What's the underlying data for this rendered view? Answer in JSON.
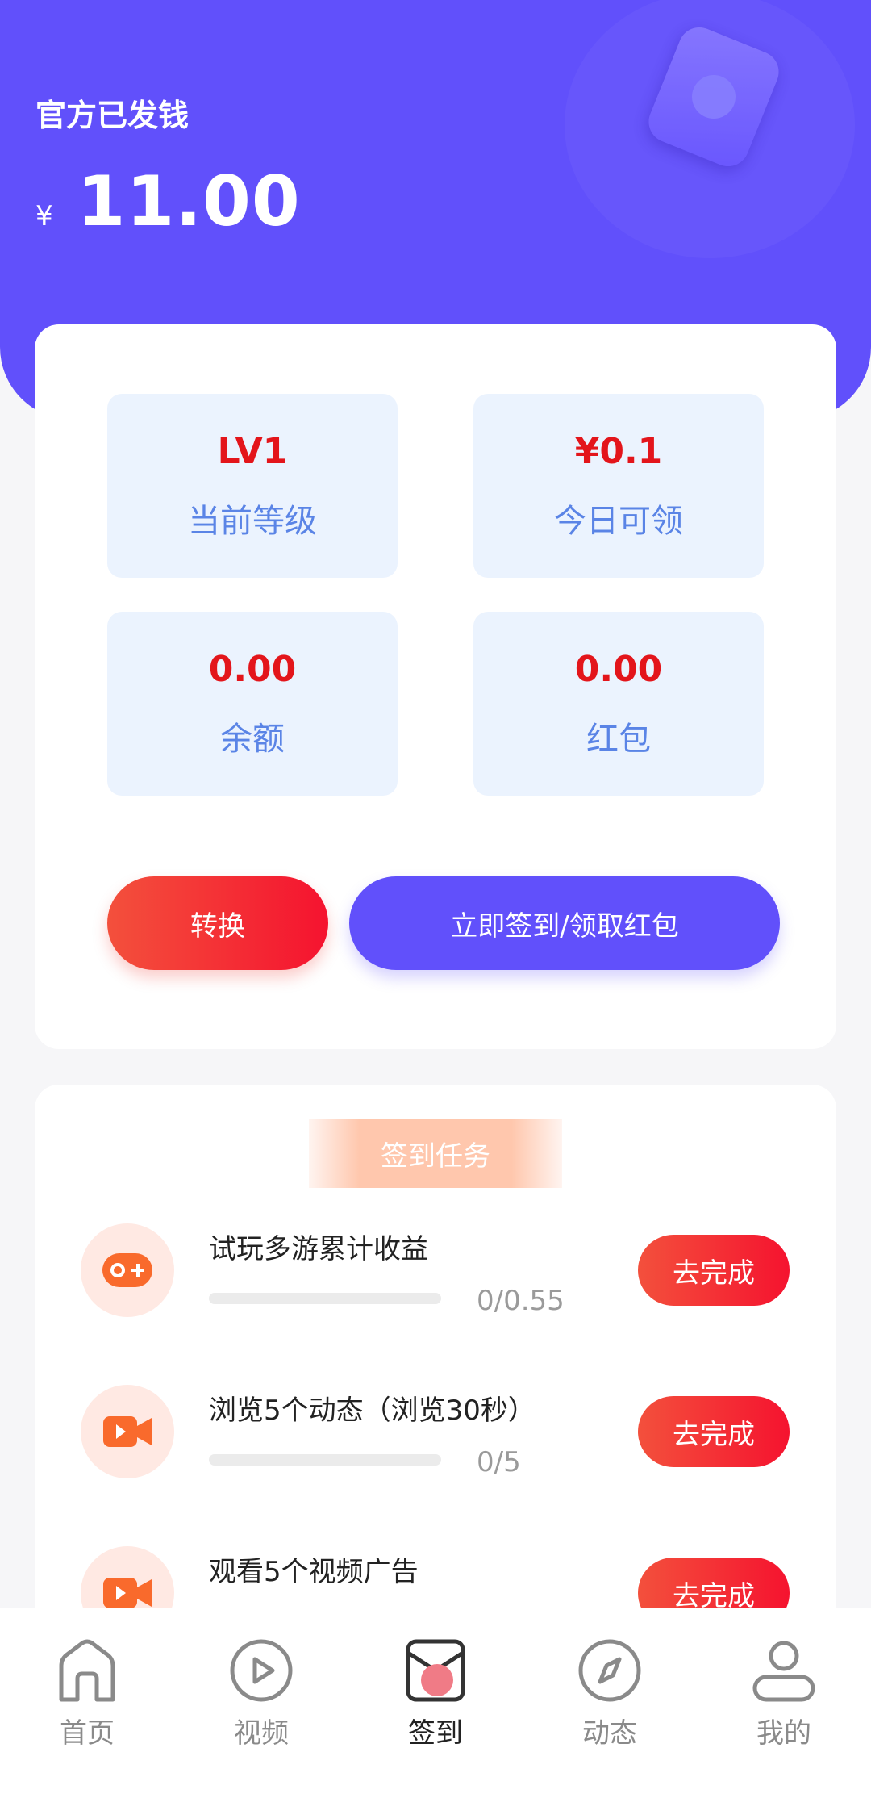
{
  "header": {
    "title": "官方已发钱",
    "currency_symbol": "¥",
    "amount": "11.00",
    "bg_color": "#6150fb"
  },
  "stats": [
    {
      "value": "LV1",
      "label": "当前等级"
    },
    {
      "value": "¥0.1",
      "label": "今日可领"
    },
    {
      "value": "0.00",
      "label": "余额"
    },
    {
      "value": "0.00",
      "label": "红包"
    }
  ],
  "actions": {
    "convert_label": "转换",
    "signin_label": "立即签到/领取红包"
  },
  "tasks": {
    "section_title": "签到任务",
    "items": [
      {
        "name": "试玩多游累计收益",
        "progress_text": "0/0.55",
        "progress_fraction": 0,
        "button_label": "去完成",
        "icon": "gamepad-icon"
      },
      {
        "name": "浏览5个动态（浏览30秒）",
        "progress_text": "0/5",
        "progress_fraction": 0,
        "button_label": "去完成",
        "icon": "video-camera-icon"
      },
      {
        "name": "观看5个视频广告",
        "progress_text": "",
        "progress_fraction": 0,
        "button_label": "去完成",
        "icon": "video-camera-icon"
      }
    ]
  },
  "tabbar": {
    "active": "签到",
    "items": [
      {
        "label": "首页",
        "icon": "home-icon"
      },
      {
        "label": "视频",
        "icon": "play-icon"
      },
      {
        "label": "签到",
        "icon": "sign-in-envelope-icon"
      },
      {
        "label": "动态",
        "icon": "compass-icon"
      },
      {
        "label": "我的",
        "icon": "profile-icon"
      }
    ]
  },
  "colors": {
    "accent": "#6150fb",
    "red": "#f5132f",
    "stat_bg": "#ebf3fe",
    "stat_label": "#5a84e6"
  }
}
